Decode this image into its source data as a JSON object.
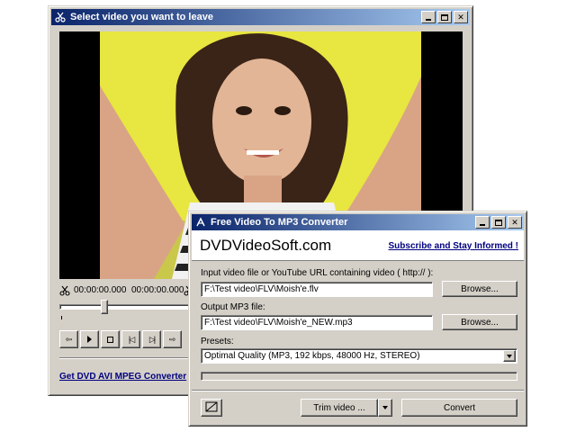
{
  "video_window": {
    "title": "Select video you want to leave",
    "start_time": "00:00:00.000",
    "end_time": "00:00:00.000",
    "link_text": "Get DVD AVI MPEG Converter"
  },
  "converter_window": {
    "title": "Free Video To MP3 Converter",
    "brand": "DVDVideoSoft.com",
    "subscribe_link": "Subscribe and Stay Informed !",
    "input_label": "Input video file or YouTube URL containing video ( http:// ):",
    "input_value": "F:\\Test video\\FLV\\Moish'e.flv",
    "output_label": "Output MP3 file:",
    "output_value": "F:\\Test video\\FLV\\Moish'e_NEW.mp3",
    "browse_label": "Browse...",
    "presets_label": "Presets:",
    "preset_value": "Optimal Quality (MP3, 192 kbps, 48000 Hz, STEREO)",
    "progress": 0,
    "trim_label": "Trim video ...",
    "convert_label": "Convert"
  },
  "colors": {
    "title_active": "#0a246a",
    "link": "#000080",
    "face": "#d4d0c8",
    "video_bg": "#e6e641"
  }
}
